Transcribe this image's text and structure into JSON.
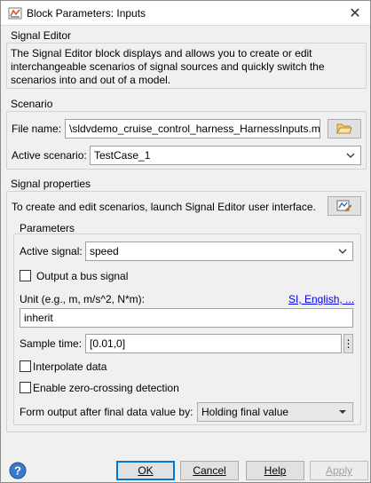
{
  "window": {
    "title": "Block Parameters: Inputs",
    "close_glyph": "✕"
  },
  "signal_editor": {
    "title": "Signal Editor",
    "description": "The Signal Editor block displays and allows you to create or edit interchangeable scenarios of signal sources and quickly switch the scenarios into and out of a model."
  },
  "scenario": {
    "title": "Scenario",
    "file_name_label": "File name:",
    "file_name_value": "\\sldvdemo_cruise_control_harness_HarnessInputs.mat",
    "active_scenario_label": "Active scenario:",
    "active_scenario_value": "TestCase_1"
  },
  "signal_properties": {
    "title": "Signal properties",
    "launch_text": "To create and edit scenarios, launch Signal Editor user interface."
  },
  "parameters": {
    "title": "Parameters",
    "active_signal_label": "Active signal:",
    "active_signal_value": "speed",
    "output_bus_label": "Output a bus signal",
    "output_bus_checked": false,
    "unit_label": "Unit (e.g., m, m/s^2, N*m):",
    "unit_link": "SI, English, ...",
    "unit_value": "inherit",
    "sample_time_label": "Sample time:",
    "sample_time_value": "[0.01,0]",
    "more_glyph": "⋮",
    "interpolate_label": "Interpolate data",
    "interpolate_checked": false,
    "zero_crossing_label": "Enable zero-crossing detection",
    "zero_crossing_checked": false,
    "form_output_label": "Form output after final data value by:",
    "form_output_value": "Holding final value"
  },
  "buttons": {
    "ok_label": "OK",
    "cancel_label": "Cancel",
    "help_label": "Help",
    "apply_label": "Apply"
  },
  "icons": {
    "app": "simulink-block-icon",
    "close": "close-icon",
    "folder": "folder-open-icon",
    "signal_editor": "signal-editor-launch-icon",
    "help": "help-question-icon",
    "chevron": "chevron-down-icon"
  },
  "colors": {
    "accent": "#0078d7",
    "link": "#0000ee",
    "panel_bg": "#f0f0f0"
  }
}
